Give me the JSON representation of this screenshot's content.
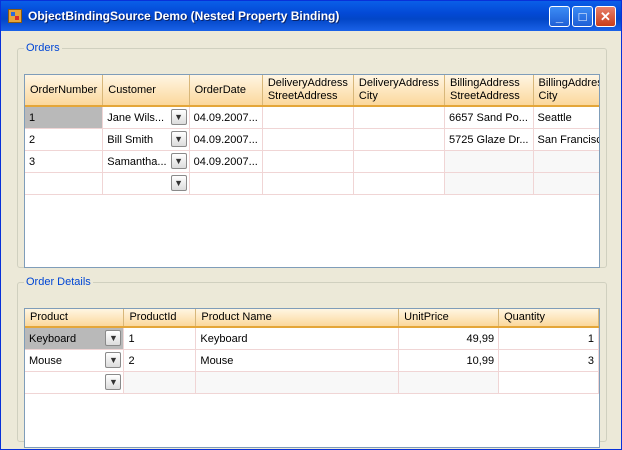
{
  "window": {
    "title": "ObjectBindingSource Demo (Nested Property Binding)"
  },
  "orders": {
    "legend": "Orders",
    "columns": [
      "OrderNumber",
      "Customer",
      "OrderDate",
      "DeliveryAddress StreetAddress",
      "DeliveryAddress City",
      "BillingAddress StreetAddress",
      "BillingAddress City"
    ],
    "rows": [
      {
        "number": "1",
        "customer": "Jane Wils...",
        "date": "04.09.2007...",
        "del_street": "",
        "del_city": "",
        "bill_street": "6657 Sand Po...",
        "bill_city": "Seattle"
      },
      {
        "number": "2",
        "customer": "Bill Smith",
        "date": "04.09.2007...",
        "del_street": "",
        "del_city": "",
        "bill_street": "5725 Glaze Dr...",
        "bill_city": "San Francisco"
      },
      {
        "number": "3",
        "customer": "Samantha...",
        "date": "04.09.2007...",
        "del_street": "",
        "del_city": "",
        "bill_street": "",
        "bill_city": ""
      }
    ]
  },
  "details": {
    "legend": "Order Details",
    "columns": [
      "Product",
      "ProductId",
      "Product Name",
      "UnitPrice",
      "Quantity"
    ],
    "rows": [
      {
        "product": "Keyboard",
        "id": "1",
        "name": "Keyboard",
        "price": "49,99",
        "qty": "1"
      },
      {
        "product": "Mouse",
        "id": "2",
        "name": "Mouse",
        "price": "10,99",
        "qty": "3"
      }
    ]
  },
  "icons": {
    "app": "app-icon",
    "minimize": "minimize-icon",
    "maximize": "maximize-icon",
    "close": "close-icon",
    "dropdown": "chevron-down-icon"
  }
}
